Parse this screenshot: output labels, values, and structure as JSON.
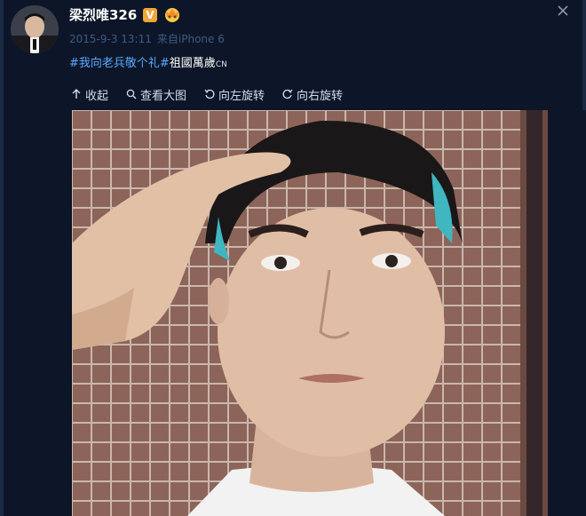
{
  "post": {
    "username": "梁烈唯326",
    "verified_badge": "V",
    "date": "2015-9-3 13:11",
    "source_prefix": "来自",
    "source": "iPhone 6",
    "hashtag": "#我向老兵敬个礼#",
    "text": "祖國萬歲",
    "suffix": "CN"
  },
  "toolbar": {
    "collapse": "收起",
    "view_large": "查看大图",
    "rotate_left": "向左旋转",
    "rotate_right": "向右旋转"
  },
  "icons": {
    "close": "close-icon",
    "crown": "crown-badge-icon",
    "collapse": "arrow-up-icon",
    "view_large": "magnify-icon",
    "rotate_left": "rotate-left-icon",
    "rotate_right": "rotate-right-icon"
  },
  "colors": {
    "background": "#0c1628",
    "hashtag": "#5aa8ff",
    "meta": "#3f5a80",
    "badge": "#f1a53a"
  }
}
